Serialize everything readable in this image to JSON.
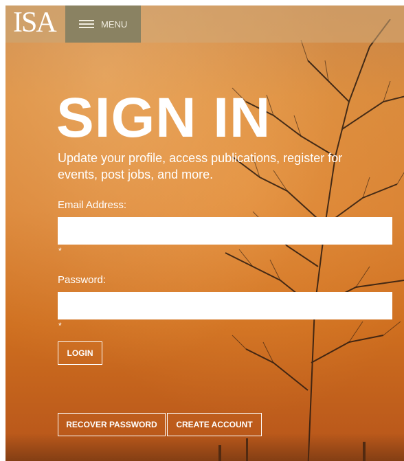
{
  "header": {
    "logo_text": "ISA",
    "menu_label": "MENU"
  },
  "main": {
    "title": "SIGN IN",
    "subtitle": "Update your profile, access publications, register for events, post jobs, and more."
  },
  "form": {
    "email_label": "Email Address:",
    "email_value": "",
    "email_required": "*",
    "password_label": "Password:",
    "password_value": "",
    "password_required": "*",
    "login_label": "LOGIN"
  },
  "footer": {
    "recover_label": "RECOVER PASSWORD",
    "create_label": "CREATE ACCOUNT"
  },
  "colors": {
    "menu_bg": "#8a8262",
    "sky": "#d98233",
    "text": "#ffffff"
  }
}
